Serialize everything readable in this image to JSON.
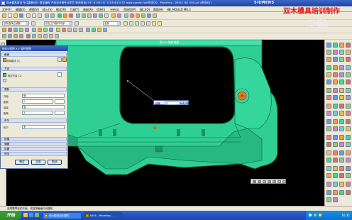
{
  "titlebar": {
    "title": "双木模具培训 专注模具设计 数控编程 产品设计等专业学员   咨询电话0797-8143132   15070815532   www.sgmjw.com在线QQ   - Modeling - [M811181-000.prt (修改的)]",
    "logo": "SIEMENS"
  },
  "watermark": {
    "text": "双木模具培训制作",
    "youku": "优酷"
  },
  "menubar": {
    "items": [
      "文件(F)",
      "编辑(E)",
      "视图(V)",
      "插入(S)",
      "格式(R)",
      "工具(T)",
      "装配(A)",
      "信息(I)",
      "分析(L)",
      "首选项(P)",
      "窗口(O)",
      "帮助(H)",
      "HB_MOULD M6.3"
    ]
  },
  "toolbar": {
    "filter_select": "没有选择过滤器",
    "assembly_select": "仅在工作部件内部",
    "scope_select": "全部"
  },
  "view": {
    "label": "视 X-Y 旋转视图"
  },
  "dialog": {
    "title": "拖动X视图 X-Y 旋转视图",
    "sections": {
      "object": "截面",
      "direction": "方向",
      "limits": "限制",
      "boolean": "布尔",
      "draft": "拔模",
      "offset": "偏置",
      "settings": "设置",
      "preview": "预览"
    },
    "select_curve": "选择曲线 (1)",
    "direction_label": "指定矢量 (1)",
    "start_label": "开始",
    "start_mode": "值",
    "start_distance_label": "距离",
    "start_distance": "0",
    "end_label": "结束",
    "end_mode": "值",
    "end_distance_label": "距离",
    "end_distance": "3",
    "boolean_label": "布尔",
    "boolean_value": "无",
    "ok_label": "确定",
    "apply_label": "应用",
    "cancel_label": "取消"
  },
  "coord_input": {
    "label": "结束",
    "value": "3"
  },
  "statusbar": {
    "text": "选择要草绘的平面，或选择截面几何图形"
  },
  "taskbar": {
    "start_label": "开始",
    "tasks": [
      "双木模具培训课件",
      "NX 6 - Modeling - ..."
    ],
    "clock": "16:31"
  },
  "colors": {
    "part": "#3ed8a0",
    "part_dark": "#1f8f64",
    "accent_orange": "#e07a20",
    "title_blue": "#2a56b8",
    "panel": "#ece9d8"
  }
}
